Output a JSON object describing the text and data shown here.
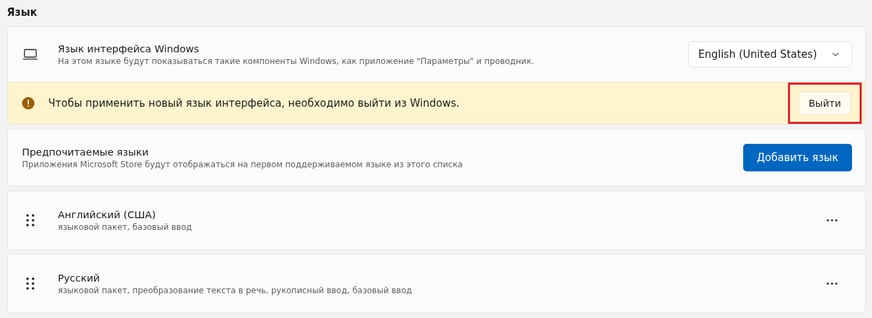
{
  "section_title": "Язык",
  "display_language": {
    "title": "Язык интерфейса Windows",
    "description": "На этом языке будут показываться такие компоненты Windows, как приложение \"Параметры\" и проводник.",
    "dropdown": {
      "value": "English (United States)"
    }
  },
  "notice": {
    "text": "Чтобы применить новый язык интерфейса, необходимо выйти из Windows.",
    "button": {
      "label": "Выйти",
      "highlighted": true
    }
  },
  "preferred": {
    "title": "Предпочитаемые языки",
    "description": "Приложения Microsoft Store будут отображаться на первом поддерживаемом языке из этого списка",
    "button": "Добавить язык"
  },
  "languages": [
    {
      "name": "Английский (США)",
      "features": "языковой пакет, базовый ввод"
    },
    {
      "name": "Русский",
      "features": "языковой пакет, преобразование текста в речь, рукописный ввод, базовый ввод"
    }
  ]
}
